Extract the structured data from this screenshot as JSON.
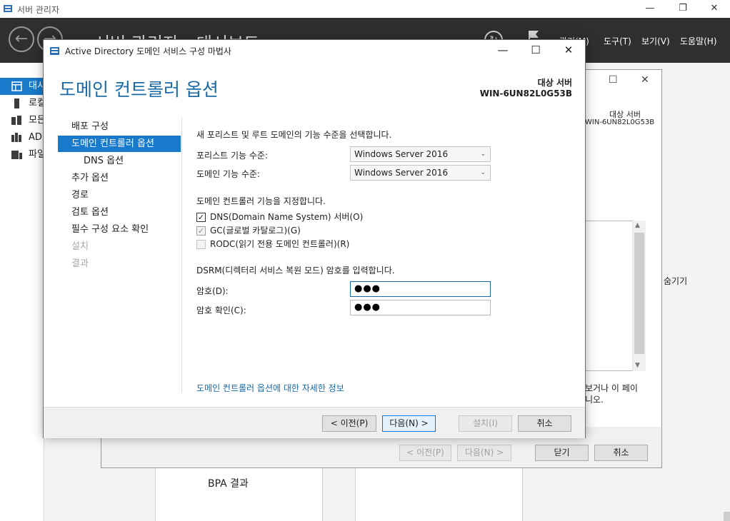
{
  "server_manager": {
    "title": "서버 관리자",
    "breadcrumb": "서버 관리자 › 대시보드",
    "window_controls": {
      "minimize": "—",
      "maximize": "❐",
      "close": "✕"
    },
    "menu": {
      "manage": "관리(M)",
      "tools": "도구(T)",
      "view": "보기(V)",
      "help": "도움말(H)"
    },
    "sidebar": [
      {
        "label": "대시보드",
        "icon": "dashboard-icon",
        "active": true
      },
      {
        "label": "로컬 서버",
        "icon": "server-icon",
        "active": false
      },
      {
        "label": "모든 서버",
        "icon": "servers-icon",
        "active": false
      },
      {
        "label": "AD DS",
        "icon": "ad-ds-icon",
        "active": false
      },
      {
        "label": "파일 및 저장소 서비스",
        "icon": "file-storage-icon",
        "active": false
      }
    ],
    "bpa_results": "BPA 결과"
  },
  "background_wizard": {
    "target_server_label": "대상 서버",
    "target_server_name": "WIN-6UN82L0G53B",
    "hide_label": "숨기기",
    "more_text_line1": "보거나 이 페이",
    "more_text_line2": "니오.",
    "buttons": {
      "prev": "< 이전(P)",
      "next": "다음(N) >",
      "close": "닫기",
      "cancel": "취소"
    }
  },
  "dialog": {
    "title": "Active Directory 도메인 서비스 구성 마법사",
    "heading": "도메인 컨트롤러 옵션",
    "target_server_label": "대상 서버",
    "target_server_name": "WIN-6UN82L0G53B",
    "steps": [
      {
        "label": "배포 구성",
        "state": "normal"
      },
      {
        "label": "도메인 컨트롤러 옵션",
        "state": "active"
      },
      {
        "label": "DNS 옵션",
        "state": "sub"
      },
      {
        "label": "추가 옵션",
        "state": "normal"
      },
      {
        "label": "경로",
        "state": "normal"
      },
      {
        "label": "검토 옵션",
        "state": "normal"
      },
      {
        "label": "필수 구성 요소 확인",
        "state": "normal"
      },
      {
        "label": "설치",
        "state": "disabled"
      },
      {
        "label": "결과",
        "state": "disabled"
      }
    ],
    "functional_level_intro": "새 포리스트 및 루트 도메인의 기능 수준을 선택합니다.",
    "forest_level_label": "포리스트 기능 수준:",
    "forest_level_value": "Windows Server 2016",
    "domain_level_label": "도메인 기능 수준:",
    "domain_level_value": "Windows Server 2016",
    "capabilities_intro": "도메인 컨트롤러 기능을 지정합니다.",
    "capabilities": [
      {
        "label": "DNS(Domain Name System) 서버(O)",
        "checked": true,
        "enabled": true
      },
      {
        "label": "GC(글로벌 카탈로그)(G)",
        "checked": true,
        "enabled": false
      },
      {
        "label": "RODC(읽기 전용 도메인 컨트롤러)(R)",
        "checked": false,
        "enabled": false
      }
    ],
    "dsrm_intro": "DSRM(디렉터리 서비스 복원 모드) 암호를 입력합니다.",
    "password_label": "암호(D):",
    "password_value": "●●●",
    "confirm_password_label": "암호 확인(C):",
    "confirm_password_value": "●●●",
    "more_info_link": "도메인 컨트롤러 옵션에 대한 자세한 정보",
    "buttons": {
      "prev": "< 이전(P)",
      "next": "다음(N) >",
      "install": "설치(I)",
      "cancel": "취소"
    },
    "window_controls": {
      "minimize": "—",
      "maximize": "☐",
      "close": "✕"
    }
  }
}
